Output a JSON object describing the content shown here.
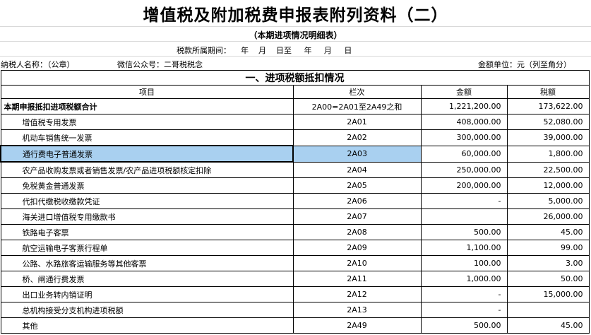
{
  "title": "增值税及附加税费申报表附列资料（二）",
  "subtitle": "（本期进项情况明细表）",
  "period": "税款所属期间：    年    月    日至     年     月     日",
  "taxpayer": "纳税人名称：（公章）",
  "wechat": "微信公众号：二哥税税念",
  "unit": "金额单位：元（列至角分）",
  "section_title": "一、进项税额抵扣情况",
  "columns": [
    "项目",
    "栏次",
    "金额",
    "税额"
  ],
  "rows": [
    {
      "item": "本期申报抵扣进项税额合计",
      "code": "2A00=2A01至2A49之和",
      "amount": "1,221,200.00",
      "tax": "173,622.00"
    },
    {
      "item": "增值税专用发票",
      "code": "2A01",
      "amount": "408,000.00",
      "tax": "52,080.00"
    },
    {
      "item": "机动车销售统一发票",
      "code": "2A02",
      "amount": "300,000.00",
      "tax": "39,000.00"
    },
    {
      "item": "通行费电子普通发票",
      "code": "2A03",
      "amount": "60,000.00",
      "tax": "1,800.00"
    },
    {
      "item": "农产品收购发票或者销售发票/农产品进项税额核定扣除",
      "code": "2A04",
      "amount": "250,000.00",
      "tax": "22,500.00"
    },
    {
      "item": "免税黄金普通发票",
      "code": "2A05",
      "amount": "200,000.00",
      "tax": "12,000.00"
    },
    {
      "item": "代扣代缴税收缴款凭证",
      "code": "2A06",
      "amount": "-",
      "tax": "5,000.00"
    },
    {
      "item": "海关进口增值税专用缴款书",
      "code": "2A07",
      "amount": "",
      "tax": "26,000.00"
    },
    {
      "item": "铁路电子客票",
      "code": "2A08",
      "amount": "500.00",
      "tax": "45.00"
    },
    {
      "item": "航空运输电子客票行程单",
      "code": "2A09",
      "amount": "1,100.00",
      "tax": "99.00"
    },
    {
      "item": "公路、水路旅客运输服务等其他客票",
      "code": "2A10",
      "amount": "100.00",
      "tax": "3.00"
    },
    {
      "item": "桥、闸通行费发票",
      "code": "2A11",
      "amount": "1,000.00",
      "tax": "50.00"
    },
    {
      "item": "出口业务转内销证明",
      "code": "2A12",
      "amount": "-",
      "tax": "15,000.00"
    },
    {
      "item": "总机构接受分支机构进项税额",
      "code": "2A13",
      "amount": "-",
      "tax": ""
    },
    {
      "item": "其他",
      "code": "2A49",
      "amount": "500.00",
      "tax": "45.00"
    }
  ]
}
